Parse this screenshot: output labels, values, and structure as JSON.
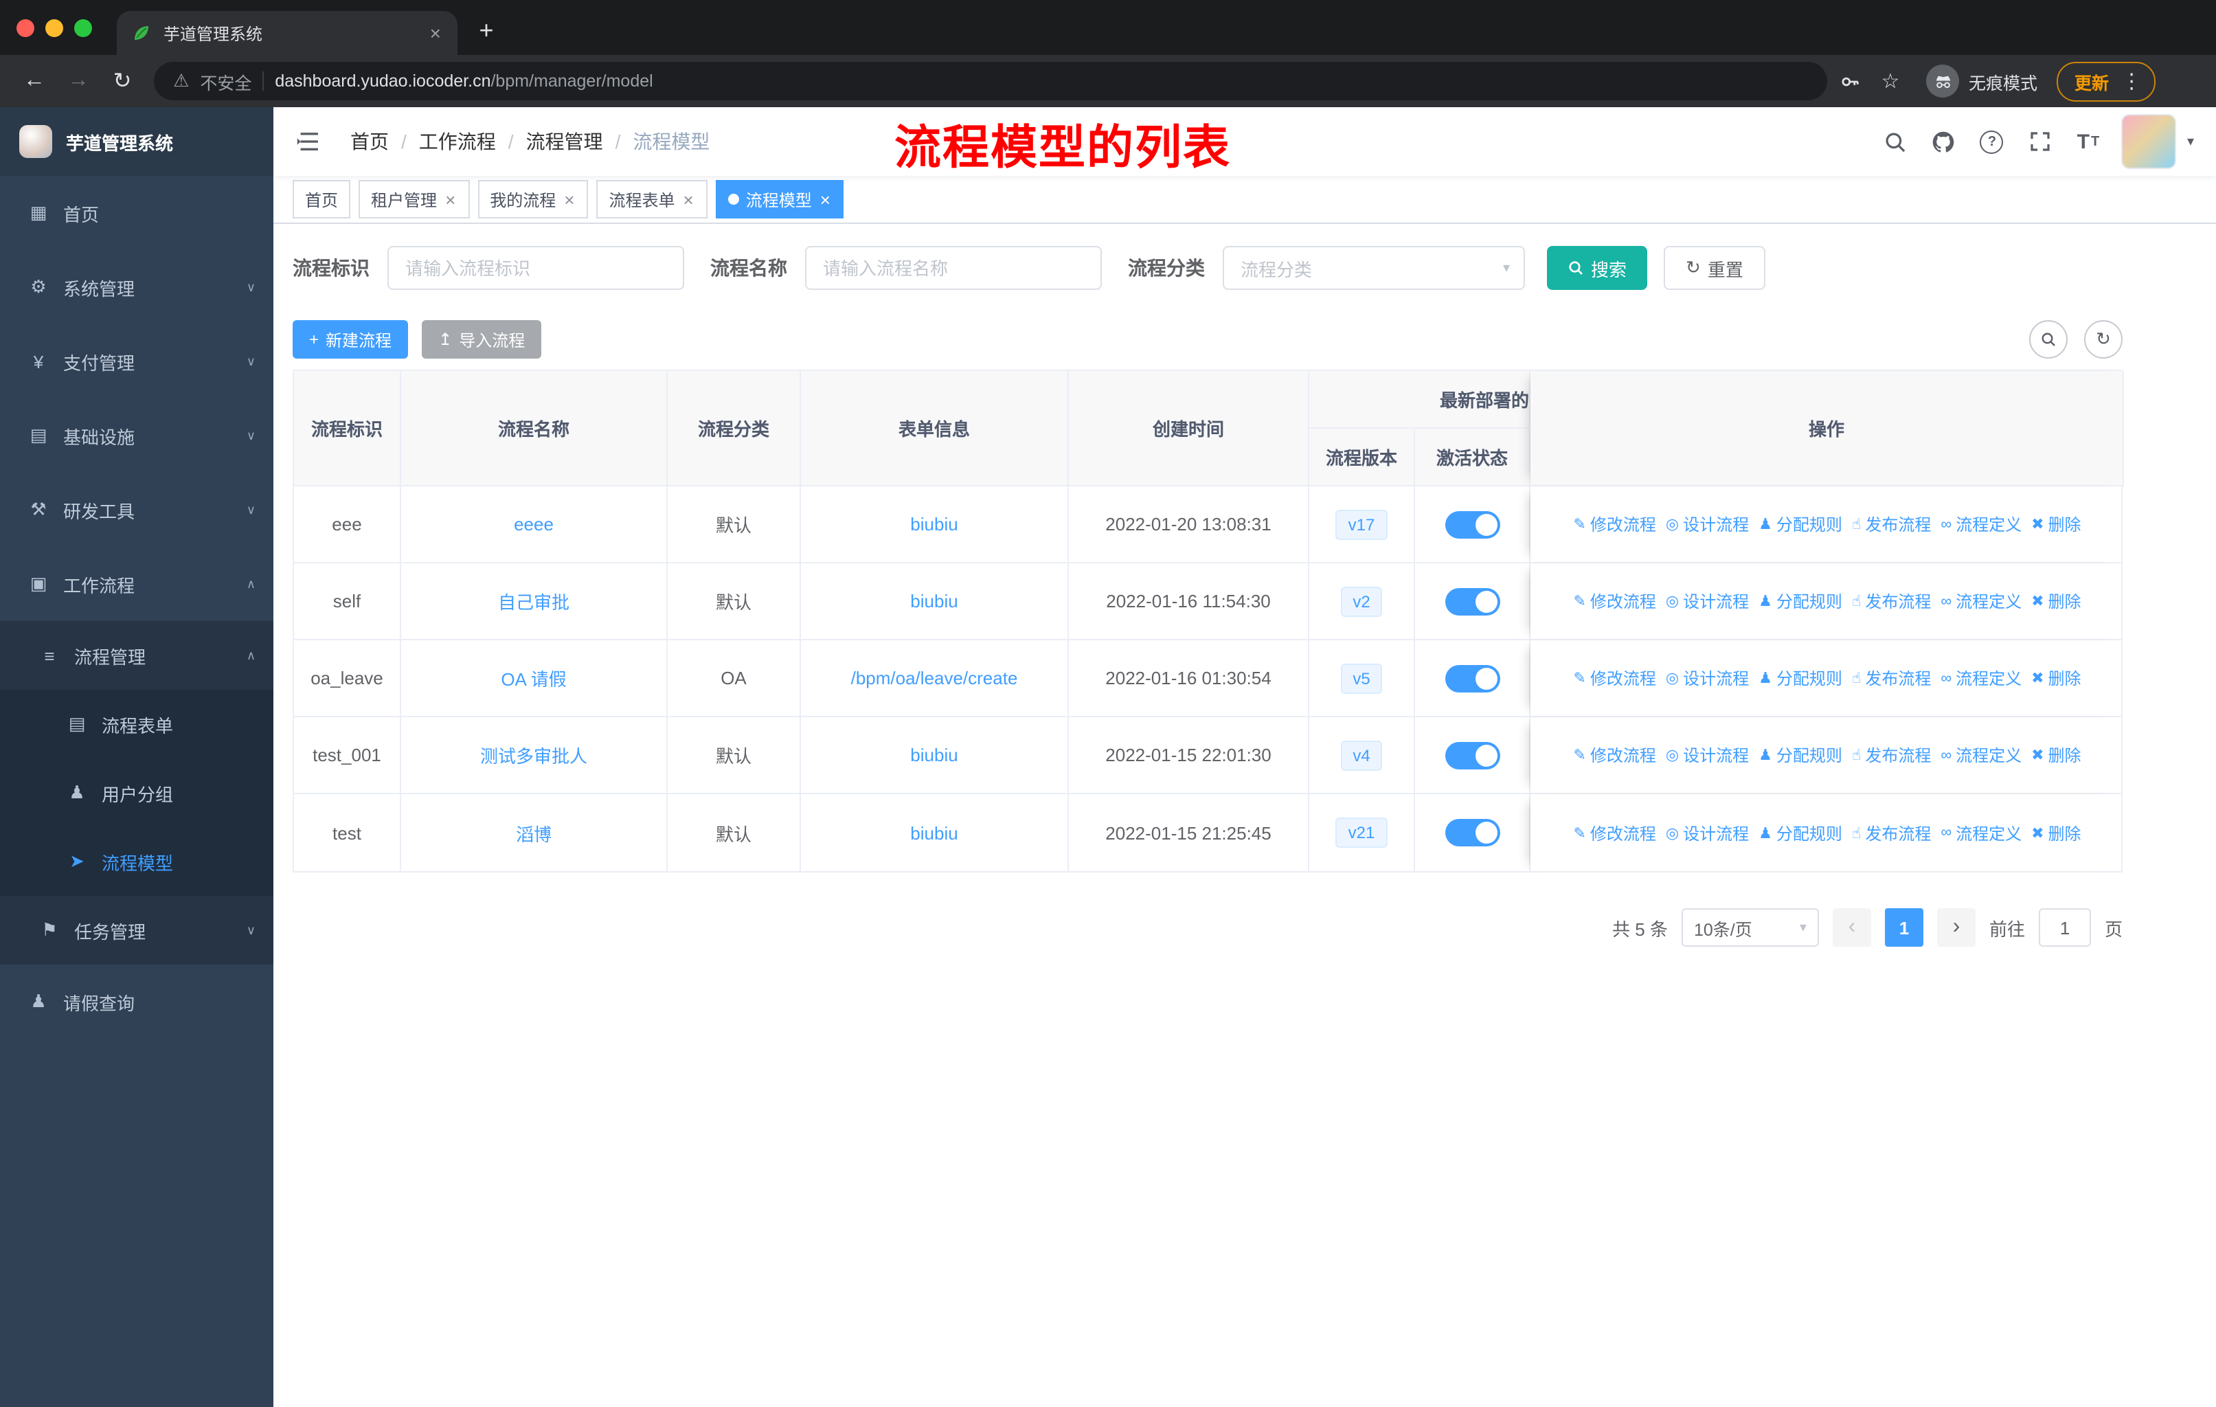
{
  "browser": {
    "tab_title": "芋道管理系统",
    "security_label": "不安全",
    "url_domain": "dashboard.yudao.iocoder.cn",
    "url_path": "/bpm/manager/model",
    "incognito_label": "无痕模式",
    "update_label": "更新"
  },
  "sidebar": {
    "title": "芋道管理系统",
    "items": [
      {
        "label": "首页",
        "glyph": "▦"
      },
      {
        "label": "系统管理",
        "glyph": "⚙",
        "chevron": "∨"
      },
      {
        "label": "支付管理",
        "glyph": "¥",
        "chevron": "∨"
      },
      {
        "label": "基础设施",
        "glyph": "▤",
        "chevron": "∨"
      },
      {
        "label": "研发工具",
        "glyph": "⚒",
        "chevron": "∨"
      },
      {
        "label": "工作流程",
        "glyph": "▣",
        "chevron": "∧"
      },
      {
        "label": "流程管理",
        "glyph": "≡",
        "chevron": "∧"
      },
      {
        "label": "流程表单",
        "glyph": "▤"
      },
      {
        "label": "用户分组",
        "glyph": "♟"
      },
      {
        "label": "流程模型",
        "glyph": "➤"
      },
      {
        "label": "任务管理",
        "glyph": "⚑",
        "chevron": "∨"
      },
      {
        "label": "请假查询",
        "glyph": "♟"
      }
    ]
  },
  "navbar": {
    "breadcrumb": [
      "首页",
      "工作流程",
      "流程管理",
      "流程模型"
    ],
    "separator": "/"
  },
  "annotation": "流程模型的列表",
  "tags": [
    {
      "label": "首页"
    },
    {
      "label": "租户管理"
    },
    {
      "label": "我的流程"
    },
    {
      "label": "流程表单"
    },
    {
      "label": "流程模型"
    }
  ],
  "filters": {
    "key_label": "流程标识",
    "key_placeholder": "请输入流程标识",
    "name_label": "流程名称",
    "name_placeholder": "请输入流程名称",
    "category_label": "流程分类",
    "category_placeholder": "流程分类",
    "search_label": "搜索",
    "reset_label": "重置"
  },
  "toolbar": {
    "create_label": "新建流程",
    "import_label": "导入流程"
  },
  "table": {
    "headers": {
      "key": "流程标识",
      "name": "流程名称",
      "category": "流程分类",
      "form": "表单信息",
      "created": "创建时间",
      "deploy_group": "最新部署的",
      "version": "流程版本",
      "status": "激活状态",
      "ops": "操作"
    },
    "ops_labels": [
      "修改流程",
      "设计流程",
      "分配规则",
      "发布流程",
      "流程定义",
      "删除"
    ],
    "rows": [
      {
        "key": "eee",
        "name": "eeee",
        "category": "默认",
        "form": "biubiu",
        "created": "2022-01-20 13:08:31",
        "version": "v17"
      },
      {
        "key": "self",
        "name": "自己审批",
        "category": "默认",
        "form": "biubiu",
        "created": "2022-01-16 11:54:30",
        "version": "v2"
      },
      {
        "key": "oa_leave",
        "name": "OA 请假",
        "category": "OA",
        "form": "/bpm/oa/leave/create",
        "created": "2022-01-16 01:30:54",
        "version": "v5"
      },
      {
        "key": "test_001",
        "name": "测试多审批人",
        "category": "默认",
        "form": "biubiu",
        "created": "2022-01-15 22:01:30",
        "version": "v4"
      },
      {
        "key": "test",
        "name": "滔博",
        "category": "默认",
        "form": "biubiu",
        "created": "2022-01-15 21:25:45",
        "version": "v21"
      }
    ]
  },
  "pagination": {
    "total": "共 5 条",
    "page_size": "10条/页",
    "current_page": "1",
    "goto_label": "前往",
    "goto_value": "1",
    "page_unit": "页"
  },
  "icons": {
    "close": "×",
    "plus": "+",
    "back": "←",
    "forward": "→",
    "reload": "↻",
    "warning": "⚠",
    "star": "☆",
    "dots": "⋮",
    "caret_down": "▾",
    "question": "?",
    "upload": "↥",
    "refresh": "↻",
    "prev": "‹",
    "next": "›",
    "edit": "✎",
    "design": "◎",
    "assign": "♟",
    "publish": "☝",
    "definition": "∞",
    "delete": "✖"
  },
  "colors": {
    "accent": "#409eff",
    "search_button": "#17b3a3",
    "annotation_red": "#ff0000",
    "sidebar_bg": "#304156"
  }
}
